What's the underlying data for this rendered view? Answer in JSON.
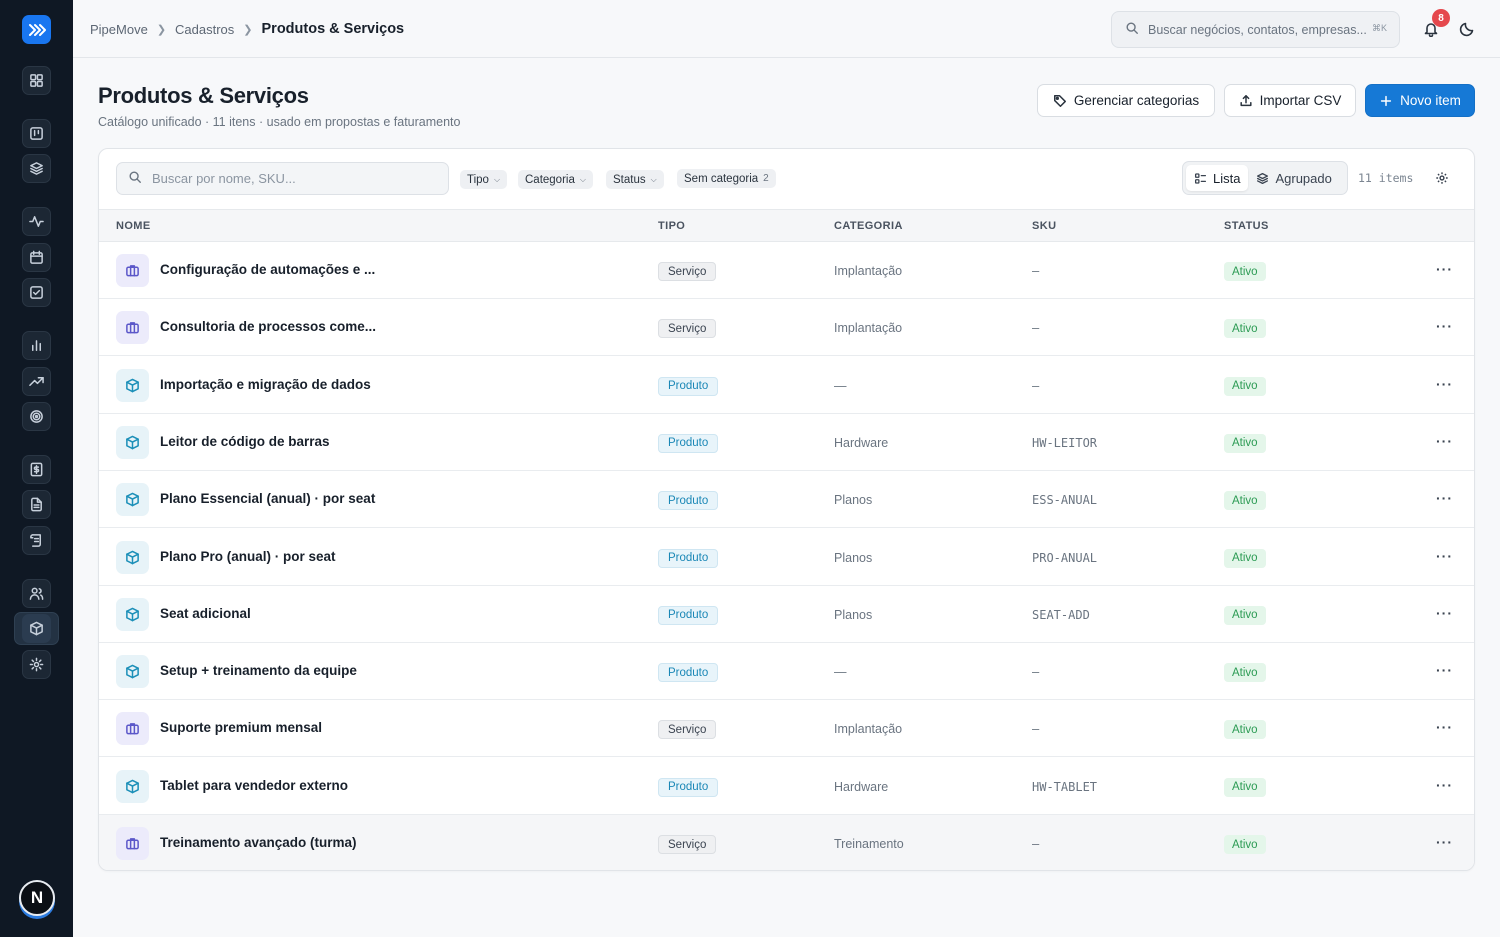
{
  "breadcrumb": {
    "root": "PipeMove",
    "parent": "Cadastros",
    "current": "Produtos & Serviços"
  },
  "topbar": {
    "search_placeholder": "Buscar negócios, contatos, empresas...",
    "search_shortcut": "⌘K",
    "notifications_count": "8"
  },
  "header": {
    "title": "Produtos & Serviços",
    "subtitle": "Catálogo unificado · 11 itens · usado em propostas e faturamento",
    "manage_categories": "Gerenciar categorias",
    "import_csv": "Importar CSV",
    "new_item": "Novo item"
  },
  "toolbar": {
    "search_placeholder": "Buscar por nome, SKU...",
    "filter_tipo": "Tipo",
    "filter_categoria": "Categoria",
    "filter_status": "Status",
    "filter_uncategorized": "Sem categoria",
    "filter_uncategorized_count": "2",
    "view_list": "Lista",
    "view_grouped": "Agrupado",
    "items_count": "11 items"
  },
  "table": {
    "headers": {
      "name": "NOME",
      "type": "TIPO",
      "category": "CATEGORIA",
      "sku": "SKU",
      "status": "STATUS"
    },
    "rows": [
      {
        "name": "Configuração de automações e ...",
        "type": "Serviço",
        "kind": "svc",
        "category": "Implantação",
        "sku": "—",
        "status": "Ativo"
      },
      {
        "name": "Consultoria de processos come...",
        "type": "Serviço",
        "kind": "svc",
        "category": "Implantação",
        "sku": "—",
        "status": "Ativo"
      },
      {
        "name": "Importação e migração de dados",
        "type": "Produto",
        "kind": "prd",
        "category": "—",
        "sku": "—",
        "status": "Ativo"
      },
      {
        "name": "Leitor de código de barras",
        "type": "Produto",
        "kind": "prd",
        "category": "Hardware",
        "sku": "HW-LEITOR",
        "status": "Ativo"
      },
      {
        "name": "Plano Essencial (anual) · por seat",
        "type": "Produto",
        "kind": "prd",
        "category": "Planos",
        "sku": "ESS-ANUAL",
        "status": "Ativo"
      },
      {
        "name": "Plano Pro (anual) · por seat",
        "type": "Produto",
        "kind": "prd",
        "category": "Planos",
        "sku": "PRO-ANUAL",
        "status": "Ativo"
      },
      {
        "name": "Seat adicional",
        "type": "Produto",
        "kind": "prd",
        "category": "Planos",
        "sku": "SEAT-ADD",
        "status": "Ativo"
      },
      {
        "name": "Setup + treinamento da equipe",
        "type": "Produto",
        "kind": "prd",
        "category": "—",
        "sku": "—",
        "status": "Ativo"
      },
      {
        "name": "Suporte premium mensal",
        "type": "Serviço",
        "kind": "svc",
        "category": "Implantação",
        "sku": "—",
        "status": "Ativo"
      },
      {
        "name": "Tablet para vendedor externo",
        "type": "Produto",
        "kind": "prd",
        "category": "Hardware",
        "sku": "HW-TABLET",
        "status": "Ativo"
      },
      {
        "name": "Treinamento avançado (turma)",
        "type": "Serviço",
        "kind": "svc",
        "category": "Treinamento",
        "sku": "—",
        "status": "Ativo"
      }
    ]
  },
  "user": {
    "avatar_initial": "N"
  },
  "colors": {
    "accent": "#1679d6",
    "sidebar": "#0f1824",
    "status_active": "#2c9b54"
  }
}
